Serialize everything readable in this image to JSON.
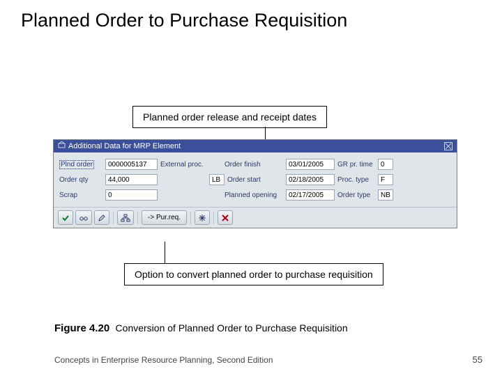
{
  "slide": {
    "title": "Planned Order to Purchase Requisition",
    "callout_top": "Planned order release and receipt dates",
    "callout_bottom": "Option to convert planned order to purchase requisition"
  },
  "dialog": {
    "title": "Additional Data for MRP Element",
    "rows": {
      "plnd_order": {
        "label": "Plnd order",
        "value": "0000005137"
      },
      "ext_proc": {
        "label": "External proc.",
        "value": ""
      },
      "order_finish": {
        "label": "Order finish",
        "value": "03/01/2005"
      },
      "gr_pr_time": {
        "label": "GR pr. time",
        "value": "0"
      },
      "order_qty": {
        "label": "Order qty",
        "value": "44,000"
      },
      "uom": {
        "value": "LB"
      },
      "order_start": {
        "label": "Order start",
        "value": "02/18/2005"
      },
      "proc_type": {
        "label": "Proc. type",
        "value": "F"
      },
      "scrap": {
        "label": "Scrap",
        "value": "0"
      },
      "planned_opening": {
        "label": "Planned opening",
        "value": "02/17/2005"
      },
      "order_type": {
        "label": "Order type",
        "value": "NB"
      }
    },
    "toolbar": {
      "pur_req_label": "-> Pur.req."
    }
  },
  "figure": {
    "number": "Figure 4.20",
    "caption": "Conversion of Planned Order to Purchase Requisition"
  },
  "footer": {
    "left": "Concepts in Enterprise Resource Planning, Second Edition",
    "page": "55"
  }
}
